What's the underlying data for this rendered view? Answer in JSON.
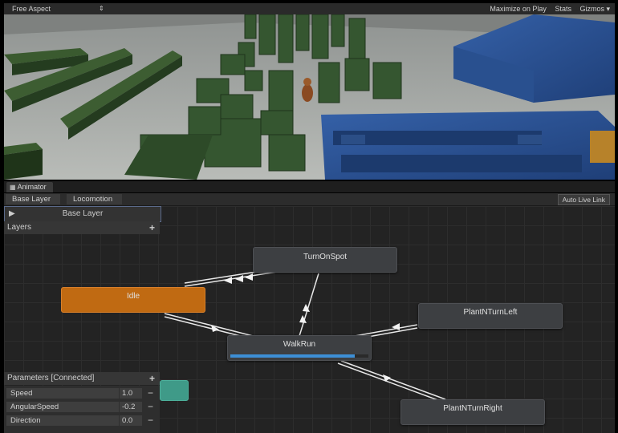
{
  "game_view": {
    "aspect_label": "Free Aspect",
    "aspect_arrow": "⇕",
    "toolbar_right": [
      "Maximize on Play",
      "Stats",
      "Gizmos ▾"
    ]
  },
  "animator": {
    "tab_label": "Animator",
    "breadcrumbs": [
      "Base Layer",
      "Locomotion"
    ],
    "auto_live_link": "Auto Live Link",
    "layer_name": "Base Layer",
    "layers_header": "Layers",
    "plus": "+",
    "params_header": "Parameters [Connected]",
    "parameters": [
      {
        "name": "Speed",
        "value": "1.0"
      },
      {
        "name": "AngularSpeed",
        "value": "-0.2"
      },
      {
        "name": "Direction",
        "value": "0.0"
      }
    ],
    "minus": "−",
    "states": {
      "idle": "Idle",
      "turnonspot": "TurnOnSpot",
      "plantleft": "PlantNTurnLeft",
      "walkrun": "WalkRun",
      "plantright": "PlantNTurnRight"
    },
    "walkrun_progress": 0.9,
    "colors": {
      "default_state": "#c06a12",
      "progress": "#3d8fd6",
      "any_state": "#3f9a88"
    }
  }
}
